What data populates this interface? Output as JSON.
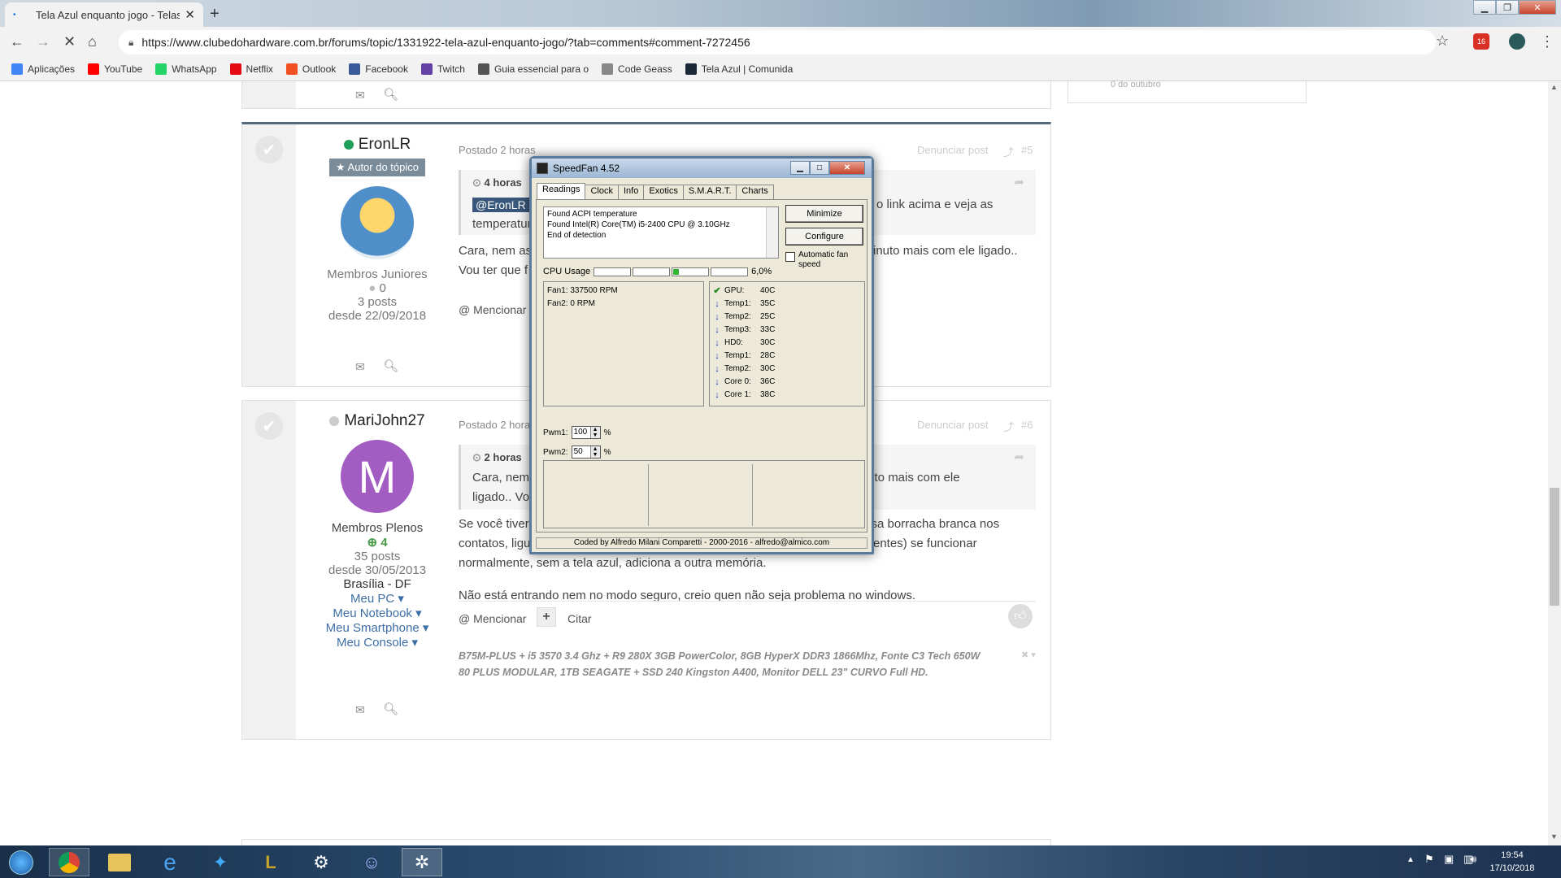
{
  "browser": {
    "tab_title": "Tela Azul enquanto jogo - Telas azuis",
    "url": "https://www.clubedohardware.com.br/forums/topic/1331922-tela-azul-enquanto-jogo/?tab=comments#comment-7272456",
    "extension_badge": "16"
  },
  "bookmarks": [
    {
      "label": "Aplicações",
      "icon": "apps-grid-icon",
      "color": "#4285f4"
    },
    {
      "label": "YouTube",
      "icon": "youtube-icon",
      "color": "#ff0000"
    },
    {
      "label": "WhatsApp",
      "icon": "whatsapp-icon",
      "color": "#25d366"
    },
    {
      "label": "Netflix",
      "icon": "netflix-icon",
      "color": "#e50914"
    },
    {
      "label": "Outlook",
      "icon": "outlook-icon",
      "color": "#f25022"
    },
    {
      "label": "Facebook",
      "icon": "facebook-icon",
      "color": "#3b5998"
    },
    {
      "label": "Twitch",
      "icon": "twitch-icon",
      "color": "#6441a5"
    },
    {
      "label": "Guia essencial para o",
      "icon": "book-icon",
      "color": "#555555"
    },
    {
      "label": "Code Geass",
      "icon": "star-icon",
      "color": "#888888"
    },
    {
      "label": "Tela Azul | Comunida",
      "icon": "steam-icon",
      "color": "#1b2838"
    }
  ],
  "post1": {
    "username": "EronLR",
    "status_color": "#1e9f5b",
    "badge": "★ Autor do tópico",
    "group": "Membros Juniores",
    "reputation": "0",
    "posts": "3 posts",
    "since": "desde 22/09/2018",
    "posted": "Postado 2 horas",
    "report": "Denunciar post",
    "number": "#5",
    "quote_header": "4 horas",
    "quote_tag": "@EronLR",
    "quote_text_a": "temperatur",
    "quote_text_b": "eixei o link acima e veja as",
    "body_a": "Cara, nem as",
    "body_b": "inuto mais com ele ligado..",
    "body_c": "Vou ter que f",
    "mention": "@ Mencionar"
  },
  "post2": {
    "username": "MariJohn27",
    "avatar_letter": "M",
    "avatar_color": "#a25cc2",
    "group": "Membros Plenos",
    "reputation": "4",
    "posts": "35 posts",
    "since": "desde 30/05/2013",
    "location": "Brasília - DF",
    "links": [
      "Meu PC ▾",
      "Meu Notebook ▾",
      "Meu Smartphone ▾",
      "Meu Console ▾"
    ],
    "posted": "Postado 2 hora",
    "report": "Denunciar post",
    "number": "#6",
    "quote_header": "2 horas",
    "quote_text_a": "Cara, nem",
    "quote_text_b": "minuto mais com ele",
    "quote_text_c": "ligado.. Vo",
    "body_line1_a": "Se você tiver",
    "body_line1_b": "ssa borracha branca nos",
    "body_line2_a": "contatos, ligu",
    "body_line2_b": "entes) se funcionar",
    "body_line3": "normalmente, sem a tela azul, adiciona a outra memória.",
    "body_line4": "Não está entrando nem no modo seguro, creio quen não seja problema no windows.",
    "mention": "@ Mencionar",
    "quote_btn": "Citar",
    "signature_1": "B75M-PLUS + i5 3570  3.4 Ghz + R9 280X 3GB PowerColor, 8GB HyperX DDR3 1866Mhz, Fonte C3 Tech  650W",
    "signature_2": "80 PLUS MODULAR, 1TB  SEAGATE + SSD 240 Kingston A400, Monitor DELL 23\" CURVO Full HD."
  },
  "rightcard_text": "0 do outubro",
  "speedfan": {
    "title": "SpeedFan 4.52",
    "tabs": [
      "Readings",
      "Clock",
      "Info",
      "Exotics",
      "S.M.A.R.T.",
      "Charts"
    ],
    "log": [
      "Found ACPI temperature",
      "Found Intel(R) Core(TM) i5-2400 CPU @ 3.10GHz",
      "End of detection"
    ],
    "minimize_label": "Minimize",
    "configure_label": "Configure",
    "auto_fan_label": "Automatic fan speed",
    "cpu_label": "CPU Usage",
    "cpu_value": "6,0%",
    "cpu_bars": [
      0,
      0,
      0.15,
      0
    ],
    "fans": [
      "Fan1: 337500 RPM",
      "Fan2: 0 RPM"
    ],
    "temps": [
      {
        "name": "GPU:",
        "value": "40C",
        "trend": "ok"
      },
      {
        "name": "Temp1:",
        "value": "35C",
        "trend": "down"
      },
      {
        "name": "Temp2:",
        "value": "25C",
        "trend": "down"
      },
      {
        "name": "Temp3:",
        "value": "33C",
        "trend": "down"
      },
      {
        "name": "HD0:",
        "value": "30C",
        "trend": "down"
      },
      {
        "name": "Temp1:",
        "value": "28C",
        "trend": "down"
      },
      {
        "name": "Temp2:",
        "value": "30C",
        "trend": "down"
      },
      {
        "name": "Core 0:",
        "value": "36C",
        "trend": "down"
      },
      {
        "name": "Core 1:",
        "value": "38C",
        "trend": "down"
      }
    ],
    "pwm1_label": "Pwm1:",
    "pwm1_value": "100",
    "pwm2_label": "Pwm2:",
    "pwm2_value": "50",
    "percent": "%",
    "status": "Coded by Alfredo Milani Comparetti - 2000-2016 - alfredo@almico.com"
  },
  "taskbar": {
    "time": "19:54",
    "date": "17/10/2018"
  }
}
